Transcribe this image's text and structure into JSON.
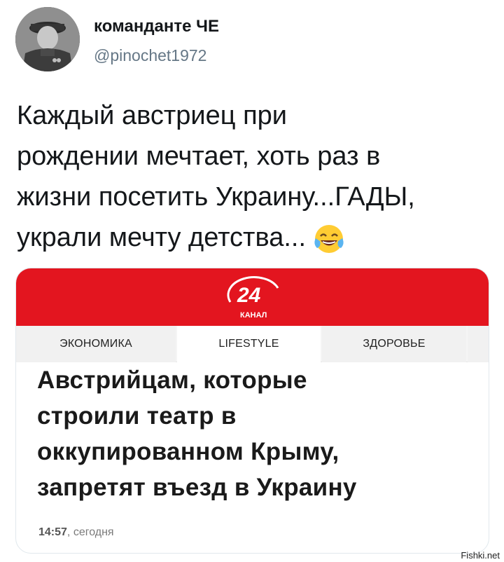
{
  "tweet": {
    "author_name": "команданте ЧЕ",
    "author_handle": "@pinochet1972",
    "text": "Каждый австриец при\nрождении мечтает, хоть раз в\nжизни посетить Украину...ГАДЫ,\nукрали мечту детства...",
    "emoji": "face-with-tears-of-joy-icon"
  },
  "card": {
    "brand_number": "24",
    "brand_label": "КАНАЛ",
    "nav_tabs": [
      "ЭКОНОМИКА",
      "LIFESTYLE",
      "ЗДОРОВЬЕ"
    ],
    "headline": "Австрийцам, которые\nстроили театр в\nоккупированном Крыму,\nзапретят въезд в Украину",
    "time": "14:57",
    "time_suffix": ", сегодня"
  },
  "watermark": "Fishki.net",
  "colors": {
    "brand_red": "#e3151f",
    "handle_gray": "#657786"
  }
}
